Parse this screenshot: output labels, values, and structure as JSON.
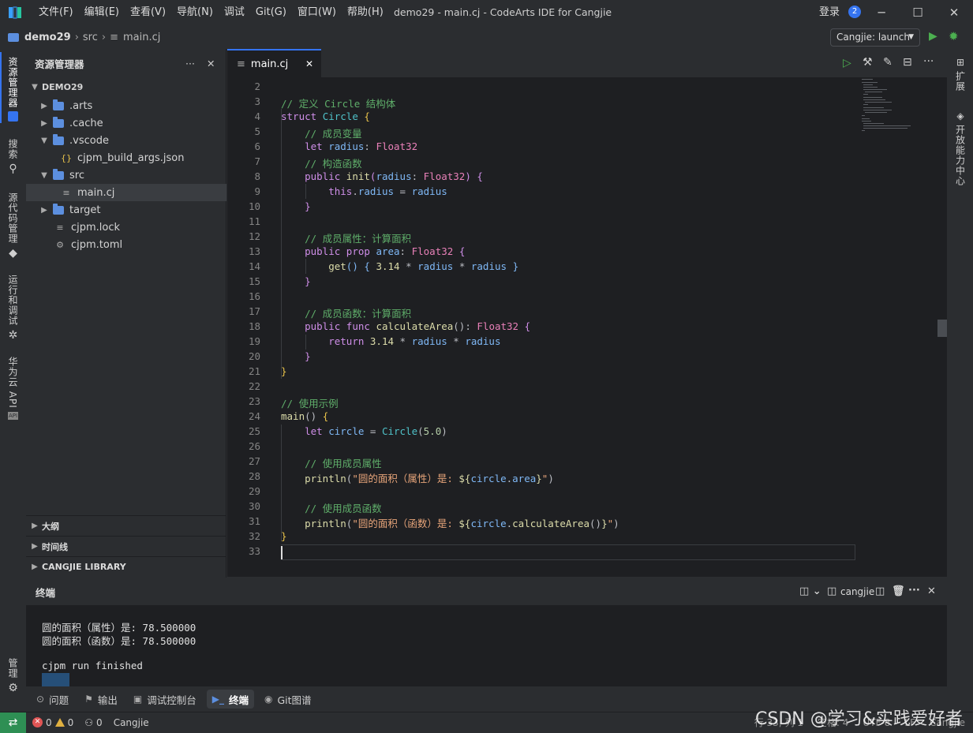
{
  "window": {
    "title": "demo29 - main.cj - CodeArts IDE for Cangjie",
    "menu": [
      "文件(F)",
      "编辑(E)",
      "查看(V)",
      "导航(N)",
      "调试",
      "Git(G)",
      "窗口(W)",
      "帮助(H)"
    ],
    "login": "登录",
    "notifications": "2"
  },
  "breadcrumb": {
    "project": "demo29",
    "folder": "src",
    "file": "main.cj"
  },
  "run_config": "Cangjie: launch",
  "activity": [
    "资源管理器",
    "搜索",
    "源代码管理",
    "运行和调试",
    "华为云 API",
    "管理"
  ],
  "right_activity": [
    "扩展",
    "开放能力中心"
  ],
  "explorer": {
    "title": "资源管理器",
    "root": "DEMO29",
    "items": [
      {
        "label": ".arts",
        "kind": "folder",
        "state": "collapsed",
        "depth": 1
      },
      {
        "label": ".cache",
        "kind": "folder",
        "state": "collapsed",
        "depth": 1
      },
      {
        "label": ".vscode",
        "kind": "folder",
        "state": "expanded",
        "depth": 1
      },
      {
        "label": "cjpm_build_args.json",
        "kind": "json",
        "state": "",
        "depth": 2
      },
      {
        "label": "src",
        "kind": "folder",
        "state": "expanded",
        "depth": 1
      },
      {
        "label": "main.cj",
        "kind": "file",
        "state": "selected",
        "depth": 2
      },
      {
        "label": "target",
        "kind": "folder",
        "state": "collapsed",
        "depth": 1
      },
      {
        "label": "cjpm.lock",
        "kind": "file",
        "state": "",
        "depth": 1
      },
      {
        "label": "cjpm.toml",
        "kind": "gear",
        "state": "",
        "depth": 1
      }
    ],
    "sections": [
      "大纲",
      "时间线",
      "CANGJIE LIBRARY"
    ]
  },
  "editor": {
    "tab": "main.cj",
    "lines": [
      {
        "n": "2",
        "html": ""
      },
      {
        "n": "3",
        "html": "<span class='cm'>// 定义 Circle 结构体</span>"
      },
      {
        "n": "4",
        "html": "<span class='kw'>struct</span> <span class='ty2'>Circle</span> <span class='br'>{</span>"
      },
      {
        "n": "5",
        "html": "    <span class='cm'>// 成员变量</span>"
      },
      {
        "n": "6",
        "html": "    <span class='kw'>let</span> <span class='id'>radius</span>: <span class='ty'>Float32</span>"
      },
      {
        "n": "7",
        "html": "    <span class='cm'>// 构造函数</span>"
      },
      {
        "n": "8",
        "html": "    <span class='kw'>public</span> <span class='fn'>init</span><span class='kw'>(</span><span class='id'>radius</span>: <span class='ty'>Float32</span><span class='kw'>)</span> <span class='kw'>{</span>"
      },
      {
        "n": "9",
        "html": "        <span class='kw'>this</span>.<span class='id'>radius</span> = <span class='id'>radius</span>"
      },
      {
        "n": "10",
        "html": "    <span class='kw'>}</span>"
      },
      {
        "n": "11",
        "html": ""
      },
      {
        "n": "12",
        "html": "    <span class='cm'>// 成员属性：计算面积</span>"
      },
      {
        "n": "13",
        "html": "    <span class='kw'>public</span> <span class='kw'>prop</span> <span class='id'>area</span>: <span class='ty'>Float32</span> <span class='kw'>{</span>"
      },
      {
        "n": "14",
        "html": "        <span class='fn'>get</span><span class='id'>()</span> <span class='id'>{</span> <span class='fn'>3.14</span> * <span class='id'>radius</span> * <span class='id'>radius</span> <span class='id'>}</span>"
      },
      {
        "n": "15",
        "html": "    <span class='kw'>}</span>"
      },
      {
        "n": "16",
        "html": ""
      },
      {
        "n": "17",
        "html": "    <span class='cm'>// 成员函数：计算面积</span>"
      },
      {
        "n": "18",
        "html": "    <span class='kw'>public</span> <span class='kw'>func</span> <span class='fn'>calculateArea</span>(): <span class='ty'>Float32</span> <span class='kw'>{</span>"
      },
      {
        "n": "19",
        "html": "        <span class='kw'>return</span> <span class='fn'>3.14</span> * <span class='id'>radius</span> * <span class='id'>radius</span>"
      },
      {
        "n": "20",
        "html": "    <span class='kw'>}</span>"
      },
      {
        "n": "21",
        "html": "<span class='br'>}</span>"
      },
      {
        "n": "22",
        "html": ""
      },
      {
        "n": "23",
        "html": "<span class='cm'>// 使用示例</span>"
      },
      {
        "n": "24",
        "html": "<span class='fn'>main</span>() <span class='br'>{</span>"
      },
      {
        "n": "25",
        "html": "    <span class='kw'>let</span> <span class='id'>circle</span> = <span class='ty2'>Circle</span>(<span class='nm'>5.0</span>)"
      },
      {
        "n": "26",
        "html": ""
      },
      {
        "n": "27",
        "html": "    <span class='cm'>// 使用成员属性</span>"
      },
      {
        "n": "28",
        "html": "    <span class='fn'>println</span>(<span class='st'>\"圆的面积（属性）是: </span><span class='fn'>${</span><span class='id'>circle</span>.<span class='id'>area</span><span class='fn'>}</span><span class='st'>\"</span>)"
      },
      {
        "n": "29",
        "html": ""
      },
      {
        "n": "30",
        "html": "    <span class='cm'>// 使用成员函数</span>"
      },
      {
        "n": "31",
        "html": "    <span class='fn'>println</span>(<span class='st'>\"圆的面积（函数）是: </span><span class='fn'>${</span><span class='id'>circle</span>.<span class='fn'>calculateArea</span>()<span class='fn'>}</span><span class='st'>\"</span>)"
      },
      {
        "n": "32",
        "html": "<span class='br'>}</span>"
      },
      {
        "n": "33",
        "html": ""
      }
    ]
  },
  "terminal": {
    "title": "终端",
    "shell": "cangjie",
    "output": [
      "圆的面积（属性）是: 78.500000",
      "圆的面积（函数）是: 78.500000",
      "",
      "cjpm run finished"
    ]
  },
  "bottom_tabs": [
    "问题",
    "输出",
    "调试控制台",
    "终端",
    "Git图谱"
  ],
  "status": {
    "errors": "0",
    "warnings": "0",
    "ports": "0",
    "language": "Cangjie",
    "right": [
      "行 33, 列 1",
      "空格: 4",
      "UTF-8",
      "LF",
      "Cangjie"
    ]
  },
  "watermark": "CSDN @学习&实践爱好者",
  "colors": {
    "accent": "#3574f0",
    "editor_bg": "#1e1f22",
    "chrome_bg": "#2b2d30",
    "remote": "#2e8f54"
  }
}
